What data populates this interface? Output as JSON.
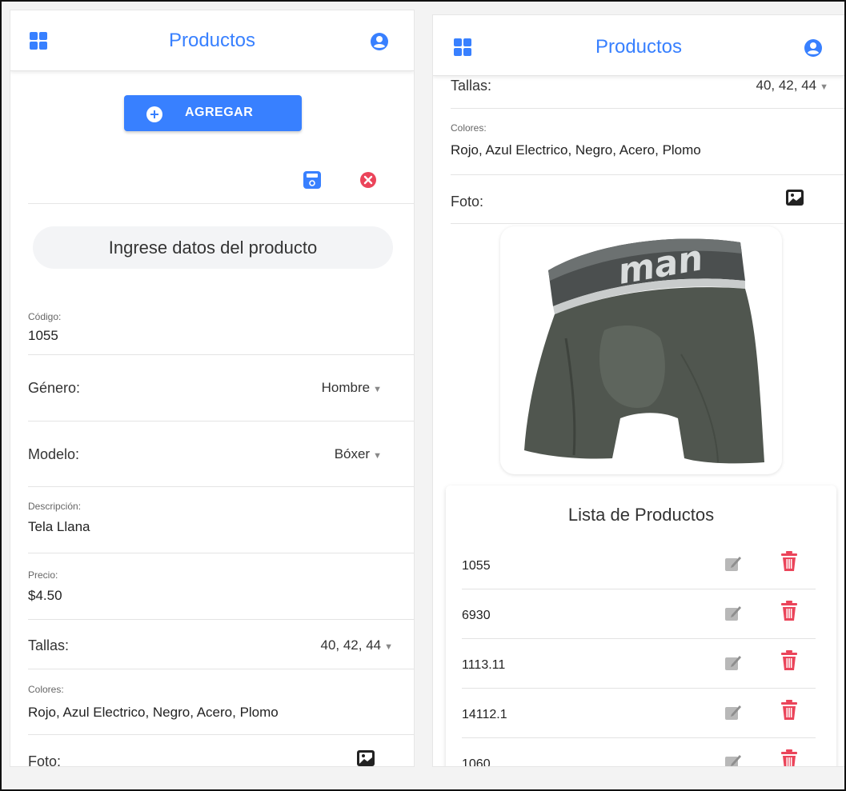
{
  "app": {
    "title": "Productos",
    "accent": "#3880ff",
    "danger": "#eb445a"
  },
  "left": {
    "toolbar_title": "Productos",
    "add_button": "AGREGAR",
    "form_header": "Ingrese datos del producto",
    "codigo": {
      "label": "Código:",
      "value": "1055"
    },
    "genero": {
      "label": "Género:",
      "value": "Hombre"
    },
    "modelo": {
      "label": "Modelo:",
      "value": "Bóxer"
    },
    "descripcion": {
      "label": "Descripción:",
      "value": "Tela Llana"
    },
    "precio": {
      "label": "Precio:",
      "value": "$4.50"
    },
    "tallas": {
      "label": "Tallas:",
      "value": "40, 42, 44"
    },
    "colores": {
      "label": "Colores:",
      "value": "Rojo, Azul Electrico, Negro, Acero, Plomo"
    },
    "foto": {
      "label": "Foto:"
    }
  },
  "right": {
    "toolbar_title": "Productos",
    "tallas": {
      "label": "Tallas:",
      "value": "40, 42, 44"
    },
    "colores": {
      "label": "Colores:",
      "value": "Rojo, Azul Electrico, Negro, Acero, Plomo"
    },
    "foto": {
      "label": "Foto:"
    },
    "product_logo_text": "man",
    "list_title": "Lista de Productos",
    "list": [
      {
        "code": "1055"
      },
      {
        "code": "6930"
      },
      {
        "code": "1113.11"
      },
      {
        "code": "14112.1"
      },
      {
        "code": "1060"
      }
    ]
  },
  "icons": {
    "menu": "grid-icon",
    "user": "person-circle-icon",
    "add": "plus-circle-icon",
    "save": "save-icon",
    "cancel": "close-circle-icon",
    "photo": "images-icon",
    "edit": "edit-icon",
    "delete": "trash-icon"
  }
}
